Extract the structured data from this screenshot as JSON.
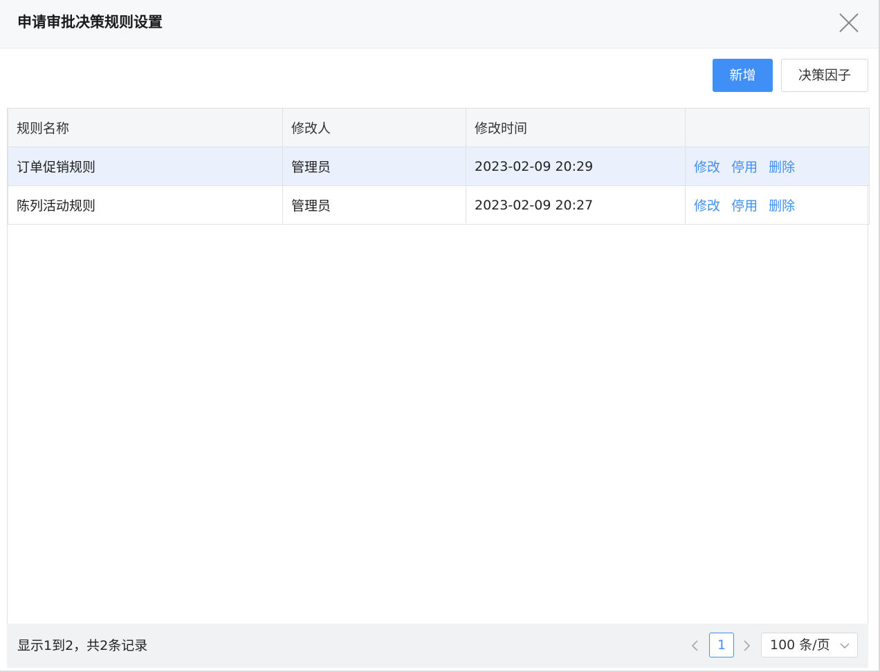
{
  "dialog": {
    "title": "申请审批决策规则设置",
    "close_icon": "close-icon"
  },
  "toolbar": {
    "add_label": "新增",
    "factor_label": "决策因子"
  },
  "table": {
    "columns": [
      "规则名称",
      "修改人",
      "修改时间",
      ""
    ],
    "rows": [
      {
        "name": "订单促销规则",
        "modifier": "管理员",
        "time": "2023-02-09 20:29",
        "actions": [
          "修改",
          "停用",
          "删除"
        ]
      },
      {
        "name": "陈列活动规则",
        "modifier": "管理员",
        "time": "2023-02-09 20:27",
        "actions": [
          "修改",
          "停用",
          "删除"
        ]
      }
    ]
  },
  "footer": {
    "record_info": "显示1到2，共2条记录",
    "current_page": "1",
    "page_size": "100 条/页",
    "prev_icon": "chevron-left-icon",
    "next_icon": "chevron-right-icon",
    "dropdown_icon": "chevron-down-icon"
  },
  "colors": {
    "primary": "#3f8ff7",
    "row_highlight": "#eaf1fd",
    "header_bg": "#f7f8fa"
  }
}
